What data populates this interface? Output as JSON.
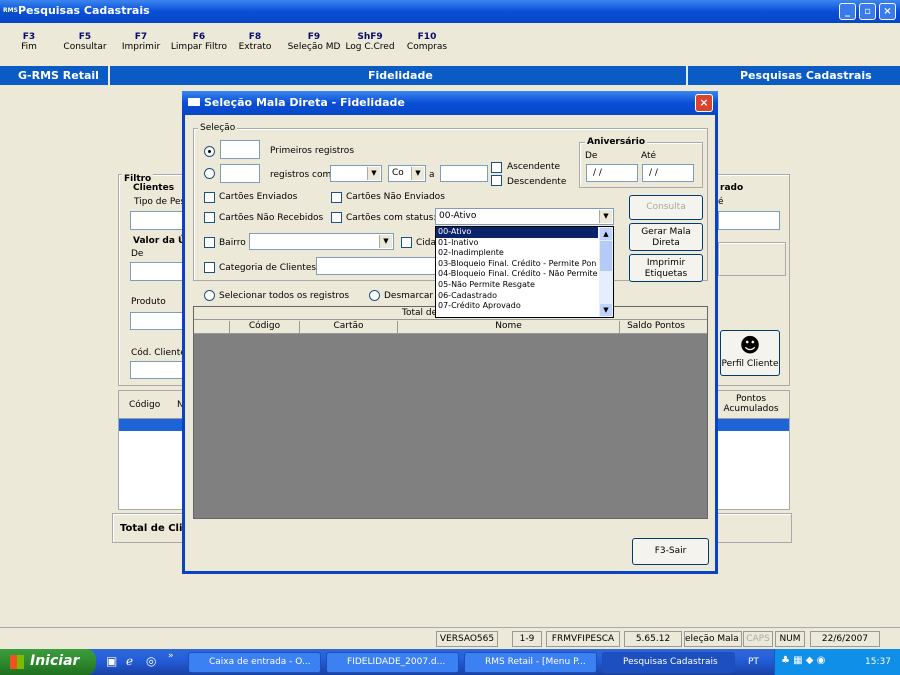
{
  "window": {
    "title": "Pesquisas Cadastrais",
    "logo": "RMS"
  },
  "fkeys": [
    {
      "key": "F3",
      "label": "Fim"
    },
    {
      "key": "F5",
      "label": "Consultar"
    },
    {
      "key": "F7",
      "label": "Imprimir"
    },
    {
      "key": "F6",
      "label": "Limpar Filtro"
    },
    {
      "key": "F8",
      "label": "Extrato"
    },
    {
      "key": "F9",
      "label": "Seleção MD"
    },
    {
      "key": "ShF9",
      "label": "Log C.Cred"
    },
    {
      "key": "F10",
      "label": "Compras"
    }
  ],
  "bluebar": {
    "left": "G-RMS Retail",
    "center": "Fidelidade",
    "right": "Pesquisas Cadastrais"
  },
  "bg": {
    "filtro": "Filtro",
    "clientes": "Clientes",
    "tipo": "Tipo de Pes",
    "valor": "Valor da Ú",
    "de": "De",
    "produto": "Produto",
    "cod_cliente": "Cód. Cliente",
    "rado": "rado",
    "e": "é",
    "perfil": "Perfil Cliente",
    "col_codigo": "Código",
    "col_n": "N",
    "col_pontos": "Pontos Acumulados",
    "total": "Total de Clie"
  },
  "dialog": {
    "title": "Seleção Mala Direta - Fidelidade",
    "selecao": "Seleção",
    "primeiros": "Primeiros registros",
    "registros_com": "registros com",
    "op": "Co",
    "a": "a",
    "ascendente": "Ascendente",
    "descendente": "Descendente",
    "aniversario": "Aniversário",
    "de": "De",
    "ate": "Até",
    "date_de": "/ /",
    "date_ate": "/ /",
    "cartoes_enviados": "Cartões Enviados",
    "cartoes_nao_enviados": "Cartões Não Enviados",
    "cartoes_nao_recebidos": "Cartões Não Recebidos",
    "cartoes_status": "Cartões com status:",
    "status_value": "00-Ativo",
    "bairro": "Bairro",
    "cidade": "Cida",
    "categoria": "Categoria de Clientes",
    "sel_todos": "Selecionar todos os registros",
    "desmarcar": "Desmarcar t",
    "btn_consulta": "Consulta",
    "btn_gerar": "Gerar Mala Direta",
    "btn_imprimir": "Imprimir Etiquetas",
    "total": "Total de",
    "cols": {
      "codigo": "Código",
      "cartao": "Cartão",
      "nome": "Nome",
      "saldo": "Saldo Pontos"
    },
    "btn_sair": "F3-Sair",
    "status_options": [
      "00-Ativo",
      "01-Inativo",
      "02-Inadimplente",
      "03-Bloqueio Final. Crédito - Permite Pon",
      "04-Bloqueio Final. Crédito - Não Permite",
      "05-Não Permite Resgate",
      "06-Cadastrado",
      "07-Crédito Aprovado"
    ]
  },
  "statusbar": {
    "versao": "VERSAO565",
    "pos": "1-9",
    "prog": "FRMVFIPESCA",
    "ver": "5.65.12",
    "sel": "eleção Mala Dire",
    "caps": "CAPS",
    "num": "NUM",
    "date": "22/6/2007"
  },
  "taskbar": {
    "start": "Iniciar",
    "items": [
      "Caixa de entrada - O...",
      "FIDELIDADE_2007.d...",
      "RMS Retail - [Menu P...",
      "Pesquisas Cadastrais"
    ],
    "lang": "PT",
    "clock": "15:37"
  }
}
